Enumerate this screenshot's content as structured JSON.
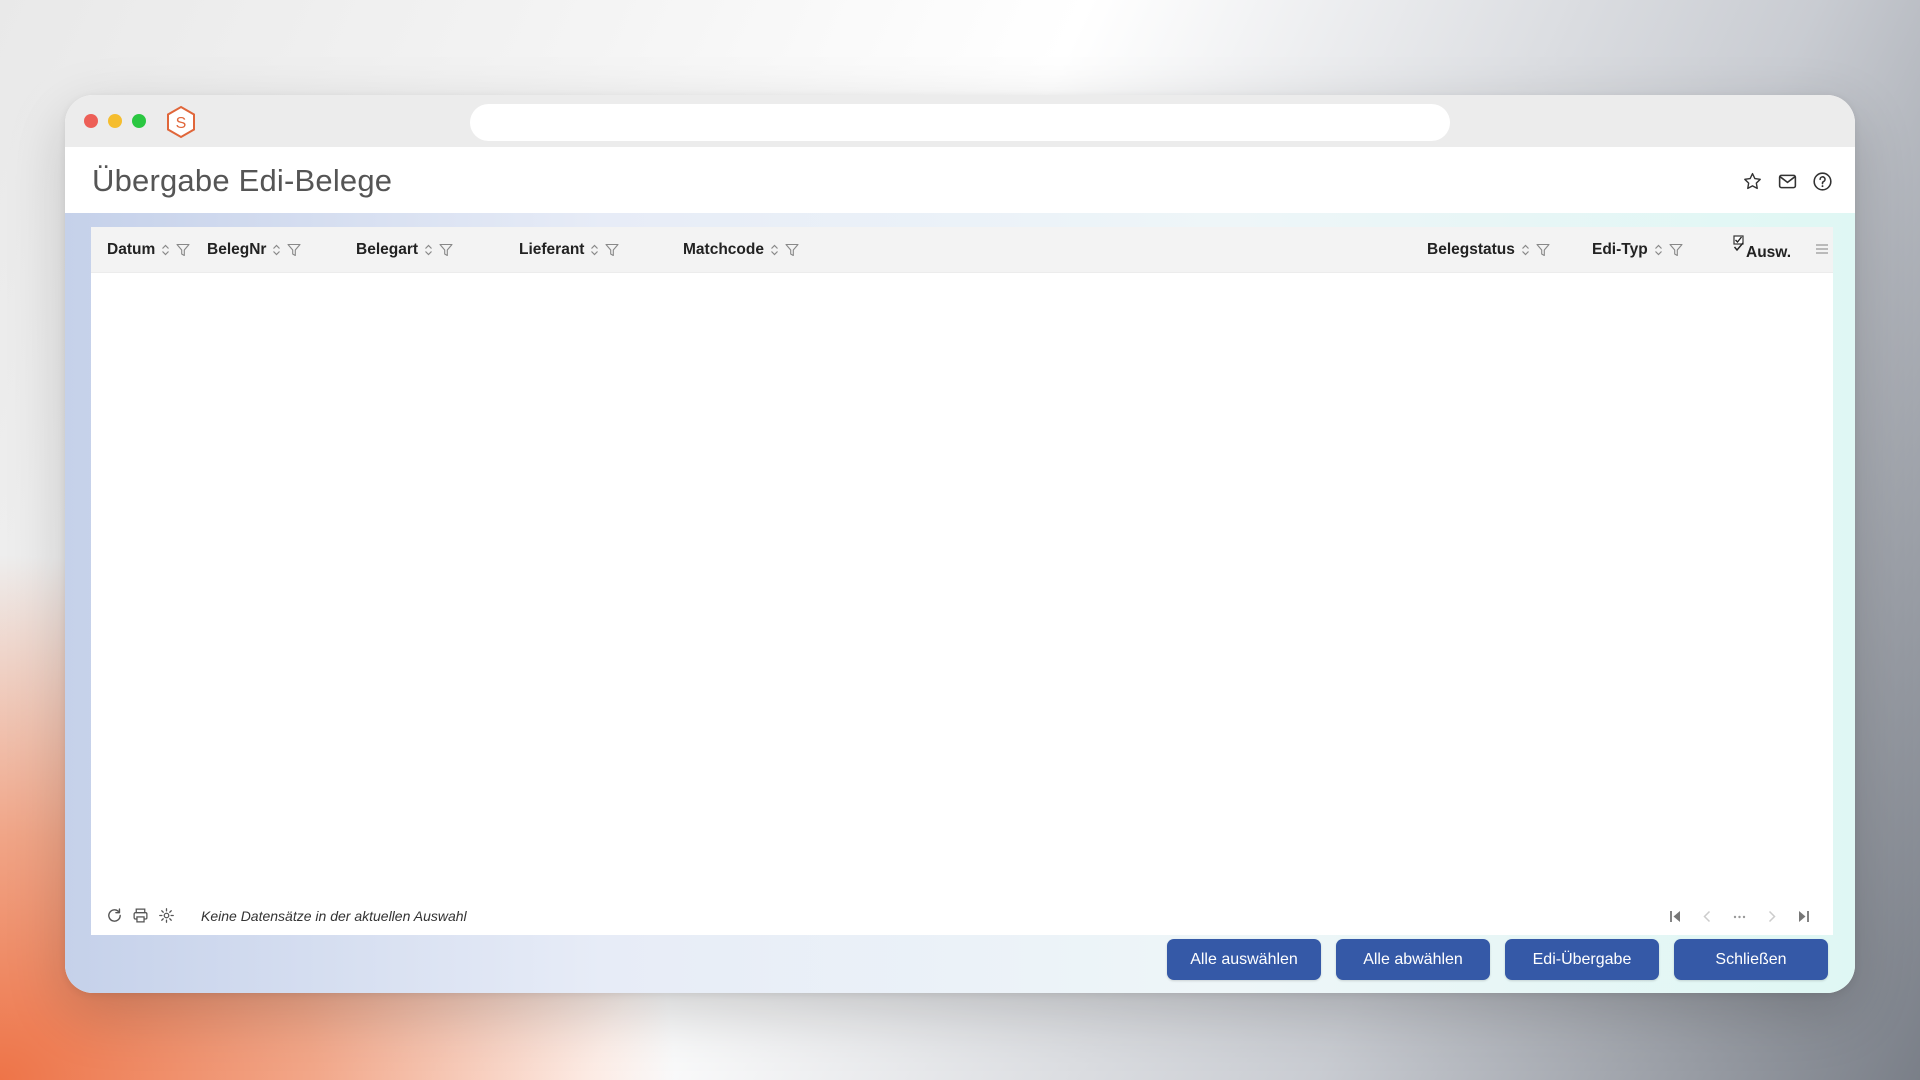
{
  "window": {
    "title": "Übergabe Edi-Belege"
  },
  "header_icons": [
    "star-icon",
    "mail-icon",
    "help-icon"
  ],
  "grid": {
    "columns": [
      {
        "label": "Datum"
      },
      {
        "label": "BelegNr"
      },
      {
        "label": "Belegart"
      },
      {
        "label": "Lieferant"
      },
      {
        "label": "Matchcode"
      },
      {
        "label": "Belegstatus"
      },
      {
        "label": "Edi-Typ"
      },
      {
        "label": "Ausw."
      }
    ],
    "rows": [],
    "status": "Keine Datensätze in der aktuellen Auswahl"
  },
  "buttons": {
    "select_all": "Alle auswählen",
    "deselect_all": "Alle abwählen",
    "edi_transfer": "Edi-Übergabe",
    "close": "Schließen"
  },
  "colors": {
    "accent": "#3559a7",
    "title": "#555555"
  }
}
